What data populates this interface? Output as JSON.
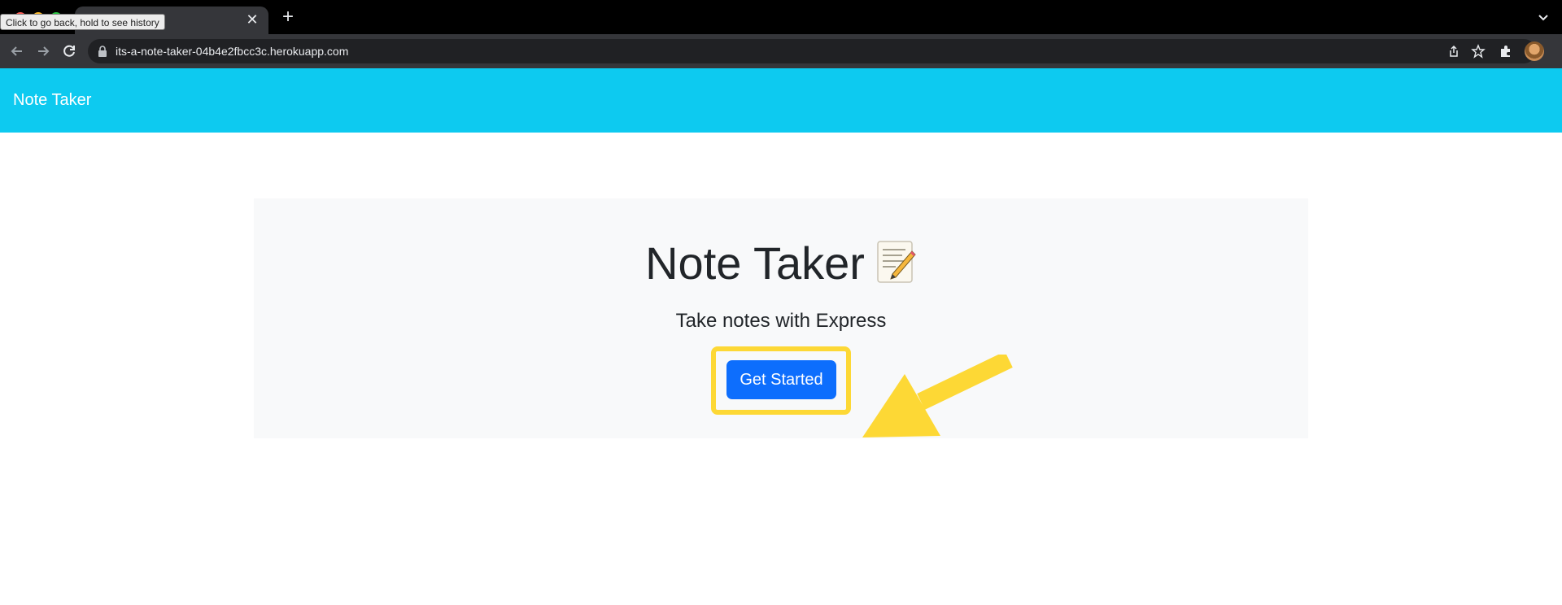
{
  "browser": {
    "tooltip": "Click to go back, hold to see history",
    "tab": {
      "close_glyph": "✕"
    },
    "new_tab_glyph": "+",
    "url": "its-a-note-taker-04b4e2fbcc3c.herokuapp.com",
    "icons": [
      "back-icon",
      "forward-icon",
      "reload-icon",
      "lock-icon",
      "share-icon",
      "star-icon",
      "extensions-icon",
      "side-panel-icon",
      "tab-search-icon"
    ]
  },
  "navbar": {
    "brand": "Note Taker",
    "color": "#0dcaf0"
  },
  "hero": {
    "title": "Note Taker",
    "lead": "Take notes with Express",
    "button_label": "Get Started",
    "button_color": "#0d6efd",
    "annotation_color": "#fdd835"
  }
}
